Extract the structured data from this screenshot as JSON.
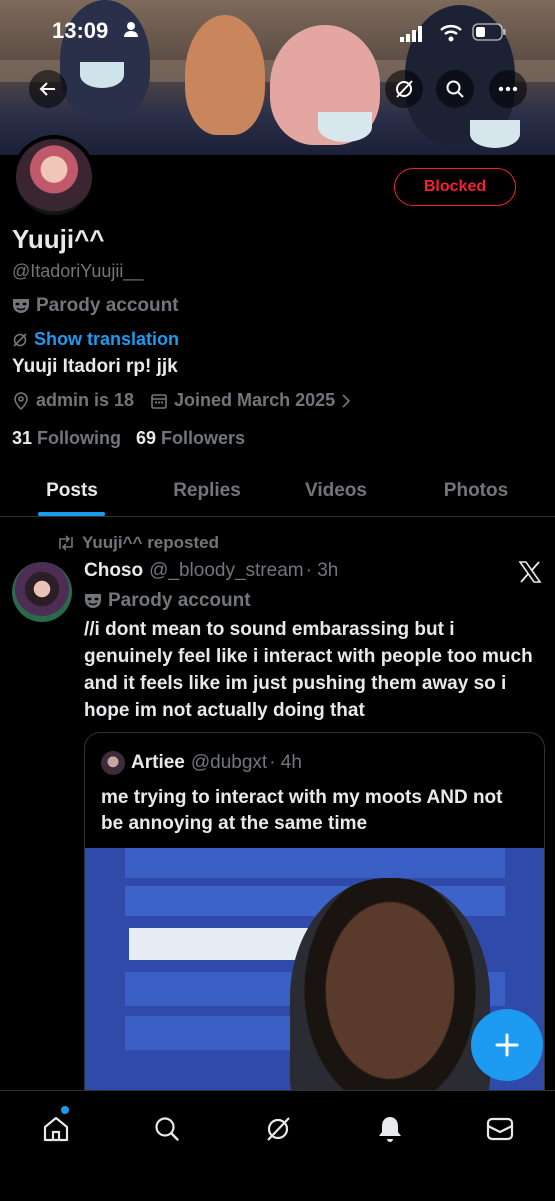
{
  "status_bar": {
    "time": "13:09"
  },
  "profile": {
    "blocked_label": "Blocked",
    "name": "Yuuji^^",
    "handle": "@ItadoriYuujii__",
    "parody_label": "Parody account",
    "translation_label": "Show translation",
    "bio": "Yuuji Itadori rp! jjk",
    "location": "admin is 18",
    "joined": "Joined March 2025",
    "following_count": "31",
    "following_label": "Following",
    "followers_count": "69",
    "followers_label": "Followers"
  },
  "tabs": [
    {
      "label": "Posts"
    },
    {
      "label": "Replies"
    },
    {
      "label": "Videos"
    },
    {
      "label": "Photos"
    }
  ],
  "post": {
    "reposted_label": "Yuuji^^ reposted",
    "author_name": "Choso",
    "author_handle": "@_bloody_stream",
    "time": "· 3h",
    "parody_label": "Parody account",
    "text": "//i dont mean to sound embarassing but i genuinely feel like i interact with people too much and it feels like im just pushing them away so i hope im not actually doing that",
    "quote": {
      "author_name": "Artiee",
      "author_handle": "@dubgxt",
      "time": "· 4h",
      "text": "me trying to interact with my moots AND not be annoying at the same time"
    }
  },
  "colors": {
    "accent": "#1d9bf0",
    "blocked": "#f4212e",
    "muted": "#71767b",
    "text": "#e7e9ea"
  },
  "icons": {
    "back": "arrow-left-icon",
    "grok": "slash-circle-icon",
    "search": "search-icon",
    "more": "more-icon",
    "nav": [
      "home-icon",
      "search-icon",
      "grok-icon",
      "bell-icon",
      "mail-icon"
    ]
  }
}
